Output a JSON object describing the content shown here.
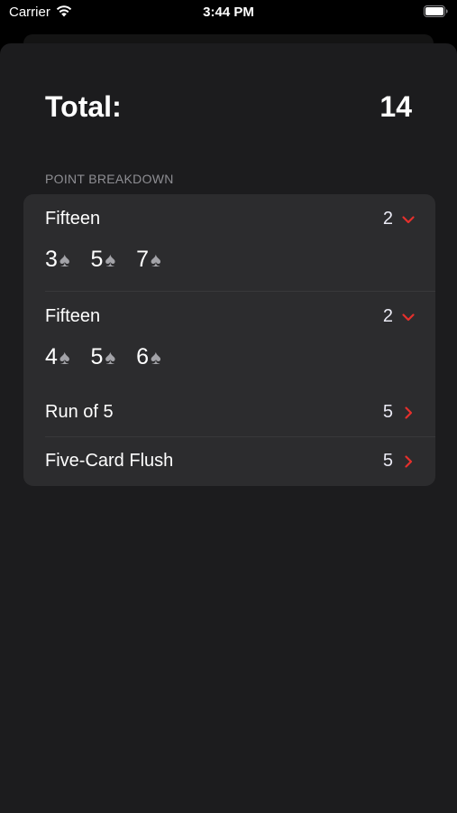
{
  "status_bar": {
    "carrier": "Carrier",
    "time": "3:44 PM",
    "wifi_icon": "wifi-icon",
    "battery_icon": "battery-icon"
  },
  "total": {
    "label": "Total:",
    "value": "14"
  },
  "section": {
    "header": "POINT BREAKDOWN"
  },
  "breakdown": [
    {
      "title": "Fifteen",
      "points": "2",
      "expanded": true,
      "cards": [
        {
          "rank": "3",
          "suit": "♠"
        },
        {
          "rank": "5",
          "suit": "♠"
        },
        {
          "rank": "7",
          "suit": "♠"
        }
      ]
    },
    {
      "title": "Fifteen",
      "points": "2",
      "expanded": true,
      "cards": [
        {
          "rank": "4",
          "suit": "♠"
        },
        {
          "rank": "5",
          "suit": "♠"
        },
        {
          "rank": "6",
          "suit": "♠"
        }
      ]
    },
    {
      "title": "Run of 5",
      "points": "5",
      "expanded": false
    },
    {
      "title": "Five-Card Flush",
      "points": "5",
      "expanded": false
    }
  ],
  "colors": {
    "accent": "#e5302c",
    "background": "#1c1c1e",
    "card_background": "#2c2c2e",
    "secondary_text": "#8e8e93"
  }
}
